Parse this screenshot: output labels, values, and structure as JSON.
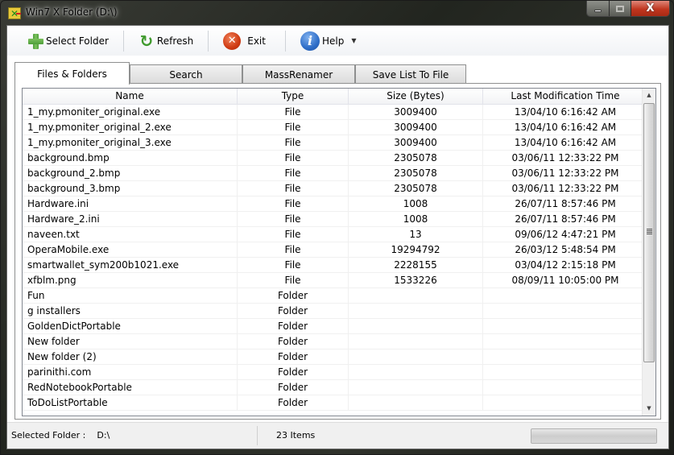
{
  "window": {
    "title": "Win7 X Folder (D:\\)",
    "icon": "app-x-icon",
    "caption_buttons": {
      "minimize": "minimize-icon",
      "maximize": "maximize-icon",
      "close": "close-icon",
      "close_glyph": "X"
    }
  },
  "toolbar": {
    "select_folder": {
      "label": "Select Folder",
      "icon": "green-plus-icon"
    },
    "refresh": {
      "label": "Refresh",
      "icon": "refresh-arrows-icon",
      "glyph": "↻"
    },
    "exit": {
      "label": "Exit",
      "icon": "red-x-circle-icon",
      "glyph": "✕"
    },
    "help": {
      "label": "Help",
      "icon": "info-icon",
      "glyph": "i",
      "dropdown_glyph": "▼"
    }
  },
  "tabs": [
    {
      "label": "Files & Folders",
      "active": true
    },
    {
      "label": "Search",
      "active": false
    },
    {
      "label": "MassRenamer",
      "active": false
    },
    {
      "label": "Save List To File",
      "active": false
    }
  ],
  "grid": {
    "columns": [
      "Name",
      "Type",
      "Size (Bytes)",
      "Last Modification Time"
    ],
    "rows": [
      {
        "name": "1_my.pmoniter_original.exe",
        "type": "File",
        "size": "3009400",
        "modified": "13/04/10 6:16:42 AM"
      },
      {
        "name": "1_my.pmoniter_original_2.exe",
        "type": "File",
        "size": "3009400",
        "modified": "13/04/10 6:16:42 AM"
      },
      {
        "name": "1_my.pmoniter_original_3.exe",
        "type": "File",
        "size": "3009400",
        "modified": "13/04/10 6:16:42 AM"
      },
      {
        "name": "background.bmp",
        "type": "File",
        "size": "2305078",
        "modified": "03/06/11 12:33:22 PM"
      },
      {
        "name": "background_2.bmp",
        "type": "File",
        "size": "2305078",
        "modified": "03/06/11 12:33:22 PM"
      },
      {
        "name": "background_3.bmp",
        "type": "File",
        "size": "2305078",
        "modified": "03/06/11 12:33:22 PM"
      },
      {
        "name": "Hardware.ini",
        "type": "File",
        "size": "1008",
        "modified": "26/07/11 8:57:46 PM"
      },
      {
        "name": "Hardware_2.ini",
        "type": "File",
        "size": "1008",
        "modified": "26/07/11 8:57:46 PM"
      },
      {
        "name": "naveen.txt",
        "type": "File",
        "size": "13",
        "modified": "09/06/12 4:47:21 PM"
      },
      {
        "name": "OperaMobile.exe",
        "type": "File",
        "size": "19294792",
        "modified": "26/03/12 5:48:54 PM"
      },
      {
        "name": "smartwallet_sym200b1021.exe",
        "type": "File",
        "size": "2228155",
        "modified": "03/04/12 2:15:18 PM"
      },
      {
        "name": "xfblm.png",
        "type": "File",
        "size": "1533226",
        "modified": "08/09/11 10:05:00 PM"
      },
      {
        "name": "Fun",
        "type": "Folder",
        "size": "",
        "modified": ""
      },
      {
        "name": "g installers",
        "type": "Folder",
        "size": "",
        "modified": ""
      },
      {
        "name": "GoldenDictPortable",
        "type": "Folder",
        "size": "",
        "modified": ""
      },
      {
        "name": "New folder",
        "type": "Folder",
        "size": "",
        "modified": ""
      },
      {
        "name": "New folder (2)",
        "type": "Folder",
        "size": "",
        "modified": ""
      },
      {
        "name": "parinithi.com",
        "type": "Folder",
        "size": "",
        "modified": ""
      },
      {
        "name": "RedNotebookPortable",
        "type": "Folder",
        "size": "",
        "modified": ""
      },
      {
        "name": "ToDoListPortable",
        "type": "Folder",
        "size": "",
        "modified": ""
      }
    ],
    "scrollbar": {
      "up_glyph": "▲",
      "down_glyph": "▼"
    }
  },
  "status": {
    "selected_folder_label": "Selected Folder :",
    "selected_folder_value": "D:\\",
    "item_count": "23 Items",
    "progress_percent": 0
  },
  "colors": {
    "close_red": "#c0361f",
    "grid_border": "#828790",
    "progress_track": "#d8d8d8"
  }
}
